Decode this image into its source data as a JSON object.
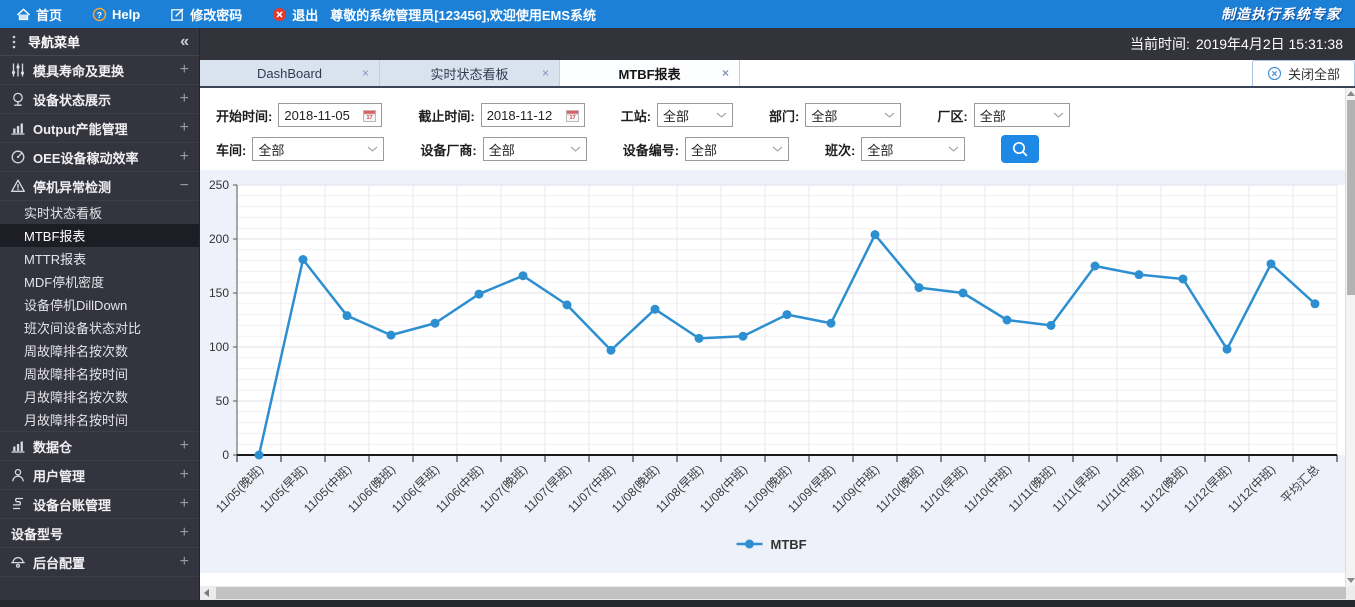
{
  "topbar": {
    "home": "首页",
    "help": "Help",
    "change_password": "修改密码",
    "logout": "退出",
    "greeting": "尊敬的系统管理员[123456],欢迎使用EMS系统",
    "brand": "制造执行系统专家"
  },
  "timebar": {
    "label": "当前时间:",
    "datetime": "2019年4月2日 15:31:38"
  },
  "sidebar": {
    "title": "导航菜单",
    "collapse_icon": "«",
    "items": [
      {
        "id": "mold-life",
        "label": "模具寿命及更换",
        "icon": "sliders-icon",
        "state": "+"
      },
      {
        "id": "device-status",
        "label": "设备状态展示",
        "icon": "display-icon",
        "state": "+"
      },
      {
        "id": "output-capacity",
        "label": "Output产能管理",
        "icon": "bar-chart-icon",
        "state": "+"
      },
      {
        "id": "oee",
        "label": "OEE设备稼动效率",
        "icon": "gauge-icon",
        "state": "+"
      },
      {
        "id": "downtime-detect",
        "label": "停机异常检测",
        "icon": "warning-triangle-icon",
        "state": "−",
        "children": [
          "实时状态看板",
          "MTBF报表",
          "MTTR报表",
          "MDF停机密度",
          "设备停机DillDown",
          "班次间设备状态对比",
          "周故障排名按次数",
          "周故障排名按时间",
          "月故障排名按次数",
          "月故障排名按时间"
        ],
        "active_child": "MTBF报表"
      },
      {
        "id": "data-warehouse",
        "label": "数据仓",
        "icon": "bar-chart-icon",
        "state": "+"
      },
      {
        "id": "user-mgmt",
        "label": "用户管理",
        "icon": "user-icon",
        "state": "+"
      },
      {
        "id": "device-ledger",
        "label": "设备台账管理",
        "icon": "ledger-icon",
        "state": "+"
      },
      {
        "id": "device-model",
        "label": "设备型号",
        "icon": "",
        "state": "+"
      },
      {
        "id": "backend-config",
        "label": "后台配置",
        "icon": "settings-icon",
        "state": "+"
      }
    ]
  },
  "tabs": [
    {
      "label": "DashBoard",
      "active": false
    },
    {
      "label": "实时状态看板",
      "active": false
    },
    {
      "label": "MTBF报表",
      "active": true
    }
  ],
  "close_all": "关闭全部",
  "filters": {
    "row1": [
      {
        "id": "start-time",
        "label": "开始时间:",
        "type": "date",
        "value": "2018-11-05"
      },
      {
        "id": "end-time",
        "label": "截止时间:",
        "type": "date",
        "value": "2018-11-12"
      },
      {
        "id": "station",
        "label": "工站:",
        "type": "select",
        "value": "全部"
      },
      {
        "id": "department",
        "label": "部门:",
        "type": "select",
        "value": "全部"
      },
      {
        "id": "factory-area",
        "label": "厂区:",
        "type": "select",
        "value": "全部"
      }
    ],
    "row2": [
      {
        "id": "workshop",
        "label": "车间:",
        "type": "select",
        "value": "全部"
      },
      {
        "id": "vendor",
        "label": "设备厂商:",
        "type": "select",
        "value": "全部"
      },
      {
        "id": "device-no",
        "label": "设备编号:",
        "type": "select",
        "value": "全部"
      },
      {
        "id": "shift",
        "label": "班次:",
        "type": "select",
        "value": "全部"
      }
    ]
  },
  "colors": {
    "topbar_blue": "#1b80d6",
    "search_blue": "#1e88e5",
    "line_blue": "#2d8fd0",
    "sidebar_bg": "#34343e",
    "active_subitem_bg": "#1d1d25",
    "chart_outer_bg": "#eef0fa"
  },
  "chart_data": {
    "type": "line",
    "title": "",
    "xlabel": "",
    "ylabel": "",
    "categories": [
      "11/05(晚班)",
      "11/05(早班)",
      "11/05(中班)",
      "11/06(晚班)",
      "11/06(早班)",
      "11/06(中班)",
      "11/07(晚班)",
      "11/07(早班)",
      "11/07(中班)",
      "11/08(晚班)",
      "11/08(早班)",
      "11/08(中班)",
      "11/09(晚班)",
      "11/09(早班)",
      "11/09(中班)",
      "11/10(晚班)",
      "11/10(早班)",
      "11/10(中班)",
      "11/11(晚班)",
      "11/11(早班)",
      "11/11(中班)",
      "11/12(晚班)",
      "11/12(早班)",
      "11/12(中班)",
      "平均汇总"
    ],
    "series": [
      {
        "name": "MTBF",
        "color": "#2d8fd0",
        "values": [
          0,
          181,
          129,
          111,
          122,
          149,
          166,
          139,
          97,
          135,
          108,
          110,
          130,
          122,
          204,
          155,
          150,
          125,
          120,
          175,
          167,
          163,
          98,
          177,
          140
        ]
      }
    ],
    "ylim": [
      0,
      250
    ],
    "yticks": [
      0,
      50,
      100,
      150,
      200,
      250
    ],
    "grid": true,
    "x_label_rotation": 45,
    "legend": {
      "position": "bottom",
      "entries": [
        "MTBF"
      ]
    }
  }
}
